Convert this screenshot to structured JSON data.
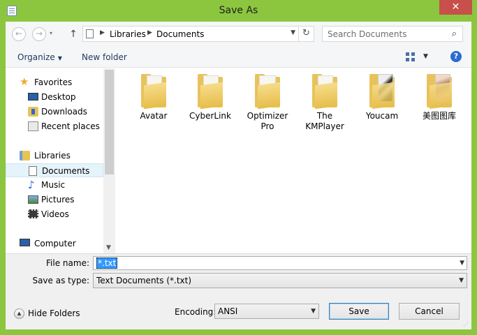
{
  "window": {
    "title": "Save As",
    "close_glyph": "✕"
  },
  "address": {
    "crumbs": [
      "Libraries",
      "Documents"
    ],
    "search_placeholder": "Search Documents"
  },
  "toolbar": {
    "organize": "Organize",
    "new_folder": "New folder"
  },
  "nav": {
    "items": [
      {
        "label": "Favorites",
        "icon": "star-icon"
      },
      {
        "label": "Desktop",
        "icon": "desktop-icon"
      },
      {
        "label": "Downloads",
        "icon": "downloads-icon"
      },
      {
        "label": "Recent places",
        "icon": "recent-places-icon"
      },
      {
        "label": "Libraries",
        "icon": "libraries-icon"
      },
      {
        "label": "Documents",
        "icon": "documents-icon",
        "selected": true
      },
      {
        "label": "Music",
        "icon": "music-icon"
      },
      {
        "label": "Pictures",
        "icon": "pictures-icon"
      },
      {
        "label": "Videos",
        "icon": "videos-icon"
      },
      {
        "label": "Computer",
        "icon": "computer-icon"
      }
    ]
  },
  "folders": [
    {
      "line1": "Avatar",
      "line2": ""
    },
    {
      "line1": "CyberLink",
      "line2": ""
    },
    {
      "line1": "Optimizer",
      "line2": "Pro"
    },
    {
      "line1": "The",
      "line2": "KMPlayer"
    },
    {
      "line1": "Youcam",
      "line2": ""
    },
    {
      "line1": "美图图库",
      "line2": ""
    }
  ],
  "form": {
    "file_name_label": "File name:",
    "file_name_value": "*.txt",
    "save_type_label": "Save as type:",
    "save_type_value": "Text Documents (*.txt)",
    "encoding_label": "Encoding:",
    "encoding_value": "ANSI"
  },
  "buttons": {
    "hide_folders": "Hide Folders",
    "save": "Save",
    "cancel": "Cancel"
  },
  "colors": {
    "frame": "#8cc63f",
    "close": "#c7504a",
    "selection": "#3399ff"
  }
}
